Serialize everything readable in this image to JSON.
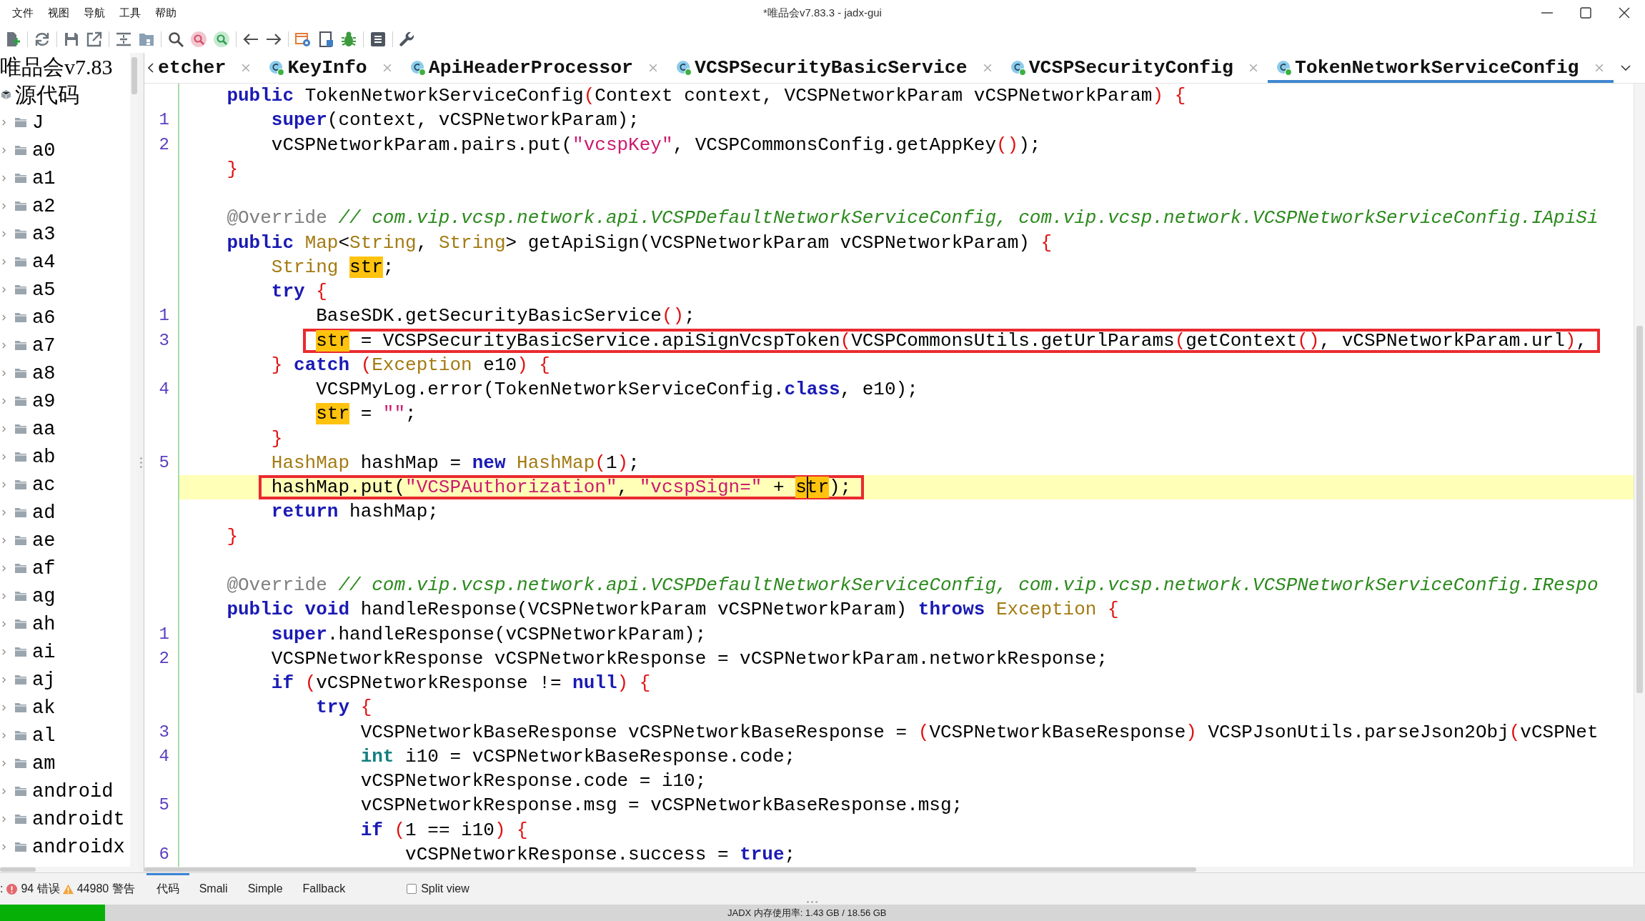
{
  "window": {
    "title": "*唯品会v7.83.3 - jadx-gui"
  },
  "menu": [
    "文件",
    "视图",
    "导航",
    "工具",
    "帮助"
  ],
  "tree": {
    "label": "唯品会v7.83",
    "children": [
      {
        "label": "源代码",
        "children": [
          {
            "label": "J",
            "expanded": false
          },
          {
            "label": "a0",
            "expanded": false
          },
          {
            "label": "a1",
            "expanded": false
          },
          {
            "label": "a2",
            "expanded": false
          },
          {
            "label": "a3",
            "expanded": false
          },
          {
            "label": "a4",
            "expanded": false
          },
          {
            "label": "a5",
            "expanded": false
          },
          {
            "label": "a6",
            "expanded": false
          },
          {
            "label": "a7",
            "expanded": false
          },
          {
            "label": "a8",
            "expanded": false
          },
          {
            "label": "a9",
            "expanded": false
          },
          {
            "label": "aa",
            "expanded": false
          },
          {
            "label": "ab",
            "expanded": false
          },
          {
            "label": "ac",
            "expanded": false
          },
          {
            "label": "ad",
            "expanded": false
          },
          {
            "label": "ae",
            "expanded": false
          },
          {
            "label": "af",
            "expanded": false
          },
          {
            "label": "ag",
            "expanded": false
          },
          {
            "label": "ah",
            "expanded": false
          },
          {
            "label": "ai",
            "expanded": false
          },
          {
            "label": "aj",
            "expanded": false
          },
          {
            "label": "ak",
            "expanded": false
          },
          {
            "label": "al",
            "expanded": false
          },
          {
            "label": "am",
            "expanded": false
          },
          {
            "label": "android",
            "expanded": false
          },
          {
            "label": "androidt",
            "expanded": false
          },
          {
            "label": "androidx",
            "expanded": false
          }
        ]
      }
    ]
  },
  "tabs": [
    {
      "label": "etcher",
      "kind": "clipped",
      "selected": false
    },
    {
      "label": "KeyInfo",
      "kind": "class",
      "selected": false
    },
    {
      "label": "ApiHeaderProcessor",
      "kind": "class",
      "selected": false
    },
    {
      "label": "VCSPSecurityBasicService",
      "kind": "class",
      "selected": false
    },
    {
      "label": "VCSPSecurityConfig",
      "kind": "class",
      "selected": false
    },
    {
      "label": "TokenNetworkServiceConfig",
      "kind": "class",
      "selected": true
    }
  ],
  "code": {
    "lines": [
      {
        "tokens": [
          {
            "kind": "kw",
            "text": "public"
          },
          {
            "kind": "plain",
            "text": " TokenNetworkServiceConfig"
          },
          {
            "kind": "sep",
            "text": "("
          },
          {
            "kind": "plain",
            "text": "Context context, VCSPNetworkParam vCSPNetworkParam"
          },
          {
            "kind": "sep",
            "text": ") {"
          }
        ],
        "boxed": false,
        "current": false,
        "children": [
          {
            "n": "1",
            "tokens": [
              {
                "kind": "kw",
                "text": "super"
              },
              {
                "kind": "plain",
                "text": "(context, vCSPNetworkParam);"
              }
            ],
            "boxed": false,
            "current": false
          },
          {
            "n": "2",
            "tokens": [
              {
                "kind": "plain",
                "text": "vCSPNetworkParam.pairs.put("
              },
              {
                "kind": "str",
                "text": "\"vcspKey\""
              },
              {
                "kind": "plain",
                "text": ", VCSPCommonsConfig.getAppKey"
              },
              {
                "kind": "sep",
                "text": "()"
              },
              {
                "kind": "plain",
                "text": ");"
              }
            ],
            "boxed": false,
            "current": false
          }
        ]
      },
      {
        "tokens": [
          {
            "kind": "sep",
            "text": "}"
          }
        ],
        "boxed": false,
        "current": false
      },
      {
        "boxed": false,
        "current": false
      },
      {
        "tokens": [
          {
            "kind": "ann",
            "text": "@Override"
          },
          {
            "kind": "cmt",
            "text": " // com.vip.vcsp.network.api.VCSPDefaultNetworkServiceConfig, com.vip.vcsp.network.VCSPNetworkServiceConfig.IApiSi"
          }
        ],
        "boxed": false,
        "current": false
      },
      {
        "tokens": [
          {
            "kind": "kw",
            "text": "public"
          },
          {
            "kind": "type",
            "text": " Map"
          },
          {
            "kind": "plain",
            "text": "<"
          },
          {
            "kind": "type",
            "text": "String"
          },
          {
            "kind": "plain",
            "text": ", "
          },
          {
            "kind": "type",
            "text": "String"
          },
          {
            "kind": "plain",
            "text": "> getApiSign(VCSPNetworkParam vCSPNetworkParam) "
          },
          {
            "kind": "sep",
            "text": "{"
          }
        ],
        "boxed": false,
        "current": false,
        "children": [
          {
            "tokens": [
              {
                "kind": "type",
                "text": "String "
              },
              {
                "kind": "mark",
                "text": "str"
              },
              {
                "kind": "plain",
                "text": ";"
              }
            ],
            "boxed": false,
            "current": false
          },
          {
            "tokens": [
              {
                "kind": "kw",
                "text": "try"
              },
              {
                "kind": "sep",
                "text": " {"
              }
            ],
            "boxed": false,
            "current": false,
            "children": [
              {
                "n": "1",
                "tokens": [
                  {
                    "kind": "plain",
                    "text": "BaseSDK.getSecurityBasicService"
                  },
                  {
                    "kind": "sep",
                    "text": "()"
                  },
                  {
                    "kind": "plain",
                    "text": ";"
                  }
                ],
                "boxed": false,
                "current": false
              },
              {
                "n": "3",
                "tokens": [
                  {
                    "kind": "mark",
                    "text": "str"
                  },
                  {
                    "kind": "plain",
                    "text": " = VCSPSecurityBasicService.apiSignVcspToken"
                  },
                  {
                    "kind": "sep",
                    "text": "("
                  },
                  {
                    "kind": "plain",
                    "text": "VCSPCommonsUtils.getUrlParams"
                  },
                  {
                    "kind": "sep",
                    "text": "("
                  },
                  {
                    "kind": "plain",
                    "text": "getContext"
                  },
                  {
                    "kind": "sep",
                    "text": "()"
                  },
                  {
                    "kind": "plain",
                    "text": ", vCSPNetworkParam.url"
                  },
                  {
                    "kind": "sep",
                    "text": ")"
                  },
                  {
                    "kind": "plain",
                    "text": ","
                  }
                ],
                "boxed": true,
                "current": false
              }
            ]
          },
          {
            "tokens": [
              {
                "kind": "sep",
                "text": "}"
              },
              {
                "kind": "kw",
                "text": " catch"
              },
              {
                "kind": "sep",
                "text": " ("
              },
              {
                "kind": "type",
                "text": "Exception"
              },
              {
                "kind": "plain",
                "text": " e10"
              },
              {
                "kind": "sep",
                "text": ") {"
              }
            ],
            "boxed": false,
            "current": false,
            "children": [
              {
                "n": "4",
                "tokens": [
                  {
                    "kind": "plain",
                    "text": "VCSPMyLog.error(TokenNetworkServiceConfig."
                  },
                  {
                    "kind": "kw",
                    "text": "class"
                  },
                  {
                    "kind": "plain",
                    "text": ", e10);"
                  }
                ],
                "boxed": false,
                "current": false
              },
              {
                "tokens": [
                  {
                    "kind": "mark",
                    "text": "str"
                  },
                  {
                    "kind": "plain",
                    "text": " = "
                  },
                  {
                    "kind": "str",
                    "text": "\"\""
                  },
                  {
                    "kind": "plain",
                    "text": ";"
                  }
                ],
                "boxed": false,
                "current": false
              }
            ]
          },
          {
            "tokens": [
              {
                "kind": "sep",
                "text": "}"
              }
            ],
            "boxed": false,
            "current": false
          },
          {
            "n": "5",
            "tokens": [
              {
                "kind": "type",
                "text": "HashMap"
              },
              {
                "kind": "plain",
                "text": " hashMap = "
              },
              {
                "kind": "kw",
                "text": "new"
              },
              {
                "kind": "type",
                "text": " HashMap"
              },
              {
                "kind": "sep",
                "text": "("
              },
              {
                "kind": "plain",
                "text": "1"
              },
              {
                "kind": "sep",
                "text": ")"
              },
              {
                "kind": "plain",
                "text": ";"
              }
            ],
            "boxed": false,
            "current": false
          },
          {
            "tokens": [
              {
                "kind": "plain",
                "text": "hashMap.put("
              },
              {
                "kind": "str",
                "text": "\"VCSPAuthorization\""
              },
              {
                "kind": "plain",
                "text": ", "
              },
              {
                "kind": "str",
                "text": "\"vcspSign=\""
              },
              {
                "kind": "plain",
                "text": " + "
              },
              {
                "kind": "mark",
                "text": "s"
              },
              {
                "kind": "caret-mark",
                "text": "tr"
              },
              {
                "kind": "plain",
                "text": ");"
              }
            ],
            "boxed": true,
            "current": true
          },
          {
            "tokens": [
              {
                "kind": "kw",
                "text": "return"
              },
              {
                "kind": "plain",
                "text": " hashMap;"
              }
            ],
            "boxed": false,
            "current": false
          }
        ]
      },
      {
        "tokens": [
          {
            "kind": "sep",
            "text": "}"
          }
        ],
        "boxed": false,
        "current": false
      },
      {
        "boxed": false,
        "current": false
      },
      {
        "tokens": [
          {
            "kind": "ann",
            "text": "@Override"
          },
          {
            "kind": "cmt",
            "text": " // com.vip.vcsp.network.api.VCSPDefaultNetworkServiceConfig, com.vip.vcsp.network.VCSPNetworkServiceConfig.IRespo"
          }
        ],
        "boxed": false,
        "current": false
      },
      {
        "tokens": [
          {
            "kind": "kw",
            "text": "public void"
          },
          {
            "kind": "plain",
            "text": " handleResponse(VCSPNetworkParam vCSPNetworkParam) "
          },
          {
            "kind": "kw",
            "text": "throws"
          },
          {
            "kind": "type",
            "text": " Exception"
          },
          {
            "kind": "sep",
            "text": " {"
          }
        ],
        "boxed": false,
        "current": false,
        "children": [
          {
            "n": "1",
            "tokens": [
              {
                "kind": "kw",
                "text": "super"
              },
              {
                "kind": "plain",
                "text": ".handleResponse(vCSPNetworkParam);"
              }
            ],
            "boxed": false,
            "current": false
          },
          {
            "n": "2",
            "tokens": [
              {
                "kind": "plain",
                "text": "VCSPNetworkResponse vCSPNetworkResponse = vCSPNetworkParam.networkResponse;"
              }
            ],
            "boxed": false,
            "current": false
          },
          {
            "tokens": [
              {
                "kind": "kw",
                "text": "if"
              },
              {
                "kind": "sep",
                "text": " ("
              },
              {
                "kind": "plain",
                "text": "vCSPNetworkResponse != "
              },
              {
                "kind": "kw",
                "text": "null"
              },
              {
                "kind": "sep",
                "text": ") {"
              }
            ],
            "boxed": false,
            "current": false,
            "children": [
              {
                "tokens": [
                  {
                    "kind": "kw",
                    "text": "try"
                  },
                  {
                    "kind": "sep",
                    "text": " {"
                  }
                ],
                "boxed": false,
                "current": false,
                "children": [
                  {
                    "n": "3",
                    "tokens": [
                      {
                        "kind": "plain",
                        "text": "VCSPNetworkBaseResponse vCSPNetworkBaseResponse = "
                      },
                      {
                        "kind": "sep",
                        "text": "("
                      },
                      {
                        "kind": "plain",
                        "text": "VCSPNetworkBaseResponse"
                      },
                      {
                        "kind": "sep",
                        "text": ")"
                      },
                      {
                        "kind": "plain",
                        "text": " VCSPJsonUtils.parseJson2Obj"
                      },
                      {
                        "kind": "sep",
                        "text": "("
                      },
                      {
                        "kind": "plain",
                        "text": "vCSPNet"
                      }
                    ],
                    "boxed": false,
                    "current": false
                  },
                  {
                    "n": "4",
                    "tokens": [
                      {
                        "kind": "prim",
                        "text": "int"
                      },
                      {
                        "kind": "plain",
                        "text": " i10 = vCSPNetworkBaseResponse.code;"
                      }
                    ],
                    "boxed": false,
                    "current": false
                  },
                  {
                    "tokens": [
                      {
                        "kind": "plain",
                        "text": "vCSPNetworkResponse.code = i10;"
                      }
                    ],
                    "boxed": false,
                    "current": false
                  },
                  {
                    "n": "5",
                    "tokens": [
                      {
                        "kind": "plain",
                        "text": "vCSPNetworkResponse.msg = vCSPNetworkBaseResponse.msg;"
                      }
                    ],
                    "boxed": false,
                    "current": false
                  },
                  {
                    "tokens": [
                      {
                        "kind": "kw",
                        "text": "if"
                      },
                      {
                        "kind": "sep",
                        "text": " ("
                      },
                      {
                        "kind": "plain",
                        "text": "1 == i10"
                      },
                      {
                        "kind": "sep",
                        "text": ") {"
                      }
                    ],
                    "boxed": false,
                    "current": false,
                    "children": [
                      {
                        "n": "6",
                        "tokens": [
                          {
                            "kind": "plain",
                            "text": "vCSPNetworkResponse.success = "
                          },
                          {
                            "kind": "kw",
                            "text": "true"
                          },
                          {
                            "kind": "plain",
                            "text": ";"
                          }
                        ],
                        "boxed": false,
                        "current": false
                      }
                    ]
                  }
                ]
              }
            ]
          }
        ]
      }
    ]
  },
  "status": {
    "prefix": ":",
    "errors": "94 错误",
    "warnings": "44980 警告"
  },
  "views": [
    {
      "label": "代码",
      "selected": true
    },
    {
      "label": "Smali",
      "selected": false
    },
    {
      "label": "Simple",
      "selected": false
    },
    {
      "label": "Fallback",
      "selected": false
    }
  ],
  "split_view": {
    "label": "Split view",
    "checked": false
  },
  "progress": {
    "level": 0.064
  },
  "memory": {
    "label": "JADX 内存使用率: 1.43 GB / 18.56 GB"
  }
}
